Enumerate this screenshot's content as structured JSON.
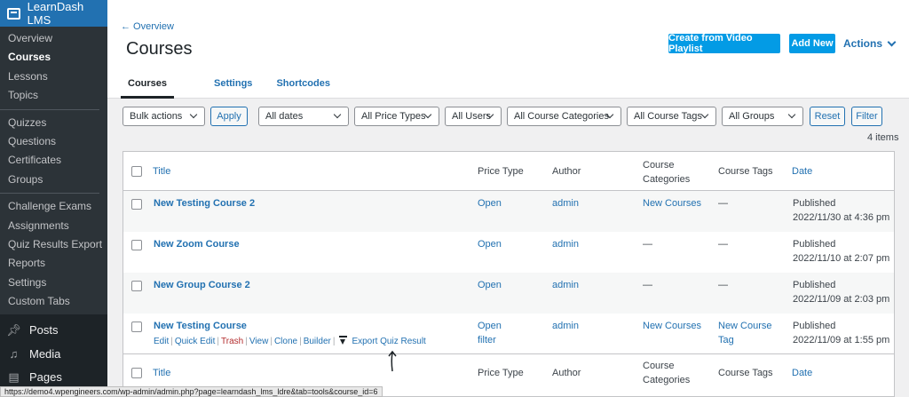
{
  "sidebar": {
    "brand": "LearnDash LMS",
    "items": [
      {
        "label": "Overview",
        "active": false
      },
      {
        "label": "Courses",
        "active": true
      },
      {
        "label": "Lessons",
        "active": false
      },
      {
        "label": "Topics",
        "active": false
      },
      {
        "label": "Quizzes",
        "active": false
      },
      {
        "label": "Questions",
        "active": false
      },
      {
        "label": "Certificates",
        "active": false
      },
      {
        "label": "Groups",
        "active": false
      },
      {
        "label": "Challenge Exams",
        "active": false
      },
      {
        "label": "Assignments",
        "active": false
      },
      {
        "label": "Quiz Results Export",
        "active": false
      },
      {
        "label": "Reports",
        "active": false
      },
      {
        "label": "Settings",
        "active": false
      },
      {
        "label": "Custom Tabs",
        "active": false
      }
    ],
    "main": [
      {
        "label": "Posts",
        "icon": "pushpin-icon"
      },
      {
        "label": "Media",
        "icon": "media-icon"
      },
      {
        "label": "Pages",
        "icon": "pages-icon"
      }
    ]
  },
  "header": {
    "back": "← Overview",
    "title": "Courses",
    "create_playlist": "Create from Video Playlist",
    "add_new": "Add New",
    "actions": "Actions",
    "tabs": [
      "Courses",
      "Settings",
      "Shortcodes"
    ]
  },
  "filters": {
    "bulk": "Bulk actions",
    "apply": "Apply",
    "dates": "All dates",
    "price_types": "All Price Types",
    "users": "All Users",
    "categories": "All Course Categories",
    "tags": "All Course Tags",
    "groups": "All Groups",
    "reset": "Reset",
    "filter": "Filter",
    "count": "4 items"
  },
  "table": {
    "columns": {
      "title": "Title",
      "price_type": "Price Type",
      "author": "Author",
      "categories_1": "Course",
      "categories_2": "Categories",
      "tags": "Course Tags",
      "date": "Date"
    },
    "rows": [
      {
        "title": "New Testing Course 2",
        "price": "Open",
        "price2": "",
        "author": "admin",
        "categories": "New Courses",
        "tags": "—",
        "tags2": "",
        "status": "Published",
        "date": "2022/11/30 at 4:36 pm"
      },
      {
        "title": "New Zoom Course",
        "price": "Open",
        "price2": "",
        "author": "admin",
        "categories": "—",
        "tags": "—",
        "tags2": "",
        "status": "Published",
        "date": "2022/11/10 at 2:07 pm"
      },
      {
        "title": "New Group Course 2",
        "price": "Open",
        "price2": "",
        "author": "admin",
        "categories": "—",
        "tags": "—",
        "tags2": "",
        "status": "Published",
        "date": "2022/11/09 at 2:03 pm"
      },
      {
        "title": "New Testing Course",
        "price": "Open",
        "price2": "filter",
        "author": "admin",
        "categories": "New Courses",
        "tags": "New Course",
        "tags2": "Tag",
        "status": "Published",
        "date": "2022/11/09 at 1:55 pm"
      }
    ],
    "row_actions": {
      "edit": "Edit",
      "quick_edit": "Quick Edit",
      "trash": "Trash",
      "view": "View",
      "clone": "Clone",
      "builder": "Builder",
      "export": "Export Quiz Result"
    }
  },
  "statusbar": "https://demo4.wpengineers.com/wp-admin/admin.php?page=learndash_lms_ldre&tab=tools&course_id=6"
}
